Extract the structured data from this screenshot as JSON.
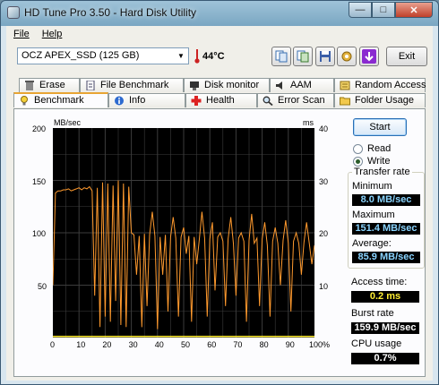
{
  "window": {
    "title": "HD Tune Pro 3.50 - Hard Disk Utility"
  },
  "menu": [
    "File",
    "Help"
  ],
  "toolbar": {
    "drive": "OCZ APEX_SSD (125 GB)",
    "temperature": "44°C",
    "exit_label": "Exit"
  },
  "tabs": {
    "row1": [
      "Erase",
      "File Benchmark",
      "Disk monitor",
      "AAM",
      "Random Access"
    ],
    "row2": [
      "Benchmark",
      "Info",
      "Health",
      "Error Scan",
      "Folder Usage"
    ],
    "active": "Benchmark"
  },
  "benchmark": {
    "start_label": "Start",
    "read_label": "Read",
    "write_label": "Write",
    "mode_selected": "Write",
    "transfer_rate_title": "Transfer rate",
    "minimum_label": "Minimum",
    "minimum_value": "8.0 MB/sec",
    "maximum_label": "Maximum",
    "maximum_value": "151.4 MB/sec",
    "average_label": "Average:",
    "average_value": "85.9 MB/sec",
    "access_time_label": "Access time:",
    "access_time_value": "0.2 ms",
    "burst_rate_label": "Burst rate",
    "burst_rate_value": "159.9 MB/sec",
    "cpu_usage_label": "CPU usage",
    "cpu_usage_value": "0.7%"
  },
  "chart_data": {
    "type": "line",
    "ylabel": "MB/sec",
    "y2label": "ms",
    "ylim": [
      0,
      200
    ],
    "y2lim": [
      0,
      40
    ],
    "y_ticks": [
      "0",
      "50",
      "100",
      "150",
      "200"
    ],
    "y2_ticks": [
      "10",
      "20",
      "30",
      "40"
    ],
    "x_ticks": [
      "0",
      "10",
      "20",
      "30",
      "40",
      "50",
      "60",
      "70",
      "80",
      "90",
      "100%"
    ],
    "xlim": [
      0,
      100
    ],
    "grid": true,
    "series": [
      {
        "name": "Transfer rate",
        "color": "#ff9a2e",
        "x": [
          0,
          1,
          2,
          3,
          4,
          5,
          6,
          7,
          8,
          9,
          10,
          11,
          12,
          13,
          14,
          15,
          16,
          17,
          18,
          19,
          20,
          21,
          22,
          23,
          24,
          25,
          26,
          27,
          28,
          29,
          30,
          31,
          32,
          33,
          34,
          35,
          36,
          37,
          38,
          39,
          40,
          41,
          42,
          43,
          44,
          45,
          46,
          47,
          48,
          49,
          50,
          51,
          52,
          53,
          54,
          55,
          56,
          57,
          58,
          59,
          60,
          61,
          62,
          63,
          64,
          65,
          66,
          67,
          68,
          69,
          70,
          71,
          72,
          73,
          74,
          75,
          76,
          77,
          78,
          79,
          80,
          81,
          82,
          83,
          84,
          85,
          86,
          87,
          88,
          89,
          90,
          91,
          92,
          93,
          94,
          95,
          96,
          97,
          98,
          99,
          100
        ],
        "values": [
          50,
          138,
          140,
          140,
          141,
          141,
          142,
          140,
          141,
          142,
          143,
          141,
          143,
          142,
          144,
          140,
          40,
          143,
          10,
          148,
          20,
          147,
          15,
          145,
          35,
          150,
          12,
          147,
          10,
          144,
          100,
          98,
          60,
          97,
          10,
          99,
          30,
          98,
          120,
          97,
          8,
          96,
          60,
          98,
          25,
          96,
          115,
          95,
          20,
          96,
          105,
          80,
          97,
          15,
          96,
          70,
          94,
          120,
          95,
          20,
          94,
          110,
          45,
          96,
          100,
          92,
          30,
          94,
          115,
          90,
          40,
          95,
          100,
          92,
          15,
          93,
          118,
          90,
          95,
          30,
          94,
          110,
          88,
          20,
          92,
          105,
          90,
          50,
          93,
          112,
          90,
          25,
          92,
          100,
          90,
          60,
          91,
          110,
          90,
          70,
          88
        ]
      },
      {
        "name": "Access time",
        "color": "#ffee33",
        "x": [
          0,
          100
        ],
        "values": [
          0.2,
          0.2
        ]
      }
    ]
  }
}
